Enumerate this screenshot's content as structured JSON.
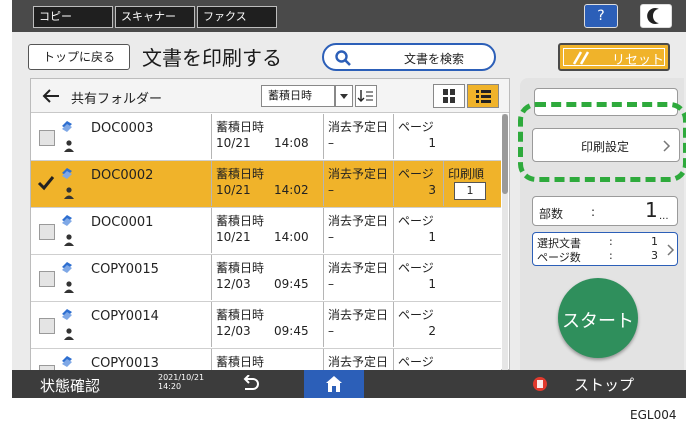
{
  "topbar": {
    "tabs": [
      "コピー",
      "スキャナー",
      "ファクス"
    ],
    "help_label": "?"
  },
  "header": {
    "back_top_label": "トップに戻る",
    "title": "文書を印刷する",
    "search_label": "文書を検索",
    "reset_label": "リセット"
  },
  "list": {
    "folder_label": "共有フォルダー",
    "sort_label": "蓄積日時",
    "rows": [
      {
        "name": "DOC0003",
        "stored_label": "蓄積日時",
        "date": "10/21",
        "time": "14:08",
        "del_label": "消去予定日",
        "del_value": "–",
        "page_label": "ページ",
        "pages": "1",
        "selected": false
      },
      {
        "name": "DOC0002",
        "stored_label": "蓄積日時",
        "date": "10/21",
        "time": "14:02",
        "del_label": "消去予定日",
        "del_value": "–",
        "page_label": "ページ",
        "pages": "3",
        "order_label": "印刷順",
        "order": "1",
        "selected": true
      },
      {
        "name": "DOC0001",
        "stored_label": "蓄積日時",
        "date": "10/21",
        "time": "14:00",
        "del_label": "消去予定日",
        "del_value": "–",
        "page_label": "ページ",
        "pages": "1",
        "selected": false
      },
      {
        "name": "COPY0015",
        "stored_label": "蓄積日時",
        "date": "12/03",
        "time": "09:45",
        "del_label": "消去予定日",
        "del_value": "–",
        "page_label": "ページ",
        "pages": "1",
        "selected": false
      },
      {
        "name": "COPY0014",
        "stored_label": "蓄積日時",
        "date": "12/03",
        "time": "09:45",
        "del_label": "消去予定日",
        "del_value": "–",
        "page_label": "ページ",
        "pages": "2",
        "selected": false
      },
      {
        "name": "COPY0013",
        "stored_label": "蓄積日時",
        "date": "",
        "time": "",
        "del_label": "消去予定日",
        "del_value": "",
        "page_label": "ページ",
        "pages": "",
        "selected": false
      }
    ]
  },
  "right": {
    "print_settings_label": "印刷設定",
    "copies_label": "部数",
    "copies_sep": ":",
    "copies_value": "1",
    "copies_suffix": "...",
    "selected_docs_label": "選択文書",
    "selected_docs_value": "1",
    "pages_label": "ページ数",
    "pages_value": "3",
    "colon": ":",
    "start_label": "スタート"
  },
  "bottom": {
    "status_label": "状態確認",
    "datetime": "2021/10/21\n14:20",
    "stop_label": "ストップ"
  },
  "caption": "EGL004",
  "colors": {
    "selected_row": "#f0b32a",
    "start_button": "#2f8f5c",
    "highlight_dash": "#2eaa3c",
    "doc_icon": "#2e6fd0",
    "stop_red": "#e03a2e"
  }
}
